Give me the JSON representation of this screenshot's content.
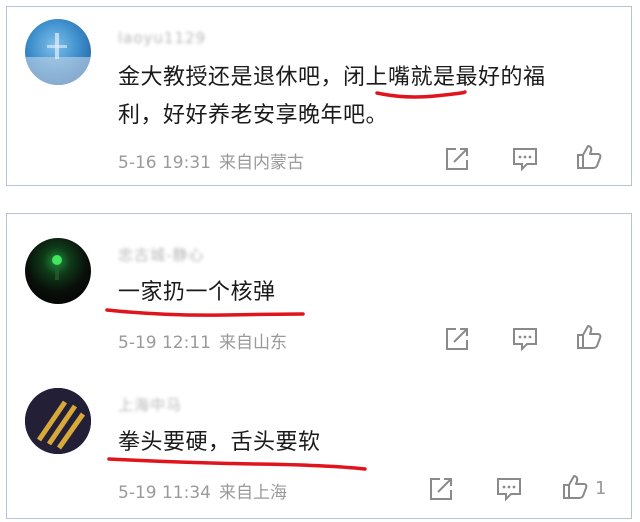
{
  "comments": [
    {
      "username": "laoyu1129",
      "text_line1": "金大教授还是退休吧，闭上嘴就是最好的福",
      "text_line2": "利，好好养老安享晚年吧。",
      "date": "5-16 19:31",
      "location": "来自内蒙古",
      "likes": ""
    },
    {
      "username": "忠古城-静心",
      "text_line1": "一家扔一个核弹",
      "date": "5-19 12:11",
      "location": "来自山东",
      "likes": ""
    },
    {
      "username": "上海中马",
      "text_line1": "拳头要硬，舌头要软",
      "date": "5-19 11:34",
      "location": "来自上海",
      "likes": "1"
    }
  ],
  "icons": {
    "share": "share-icon",
    "comment": "comment-icon",
    "like": "thumbs-up-icon"
  },
  "colors": {
    "card_border": "#b9c0dd",
    "underline": "#e0141c",
    "meta_text": "#9a9a9a"
  }
}
